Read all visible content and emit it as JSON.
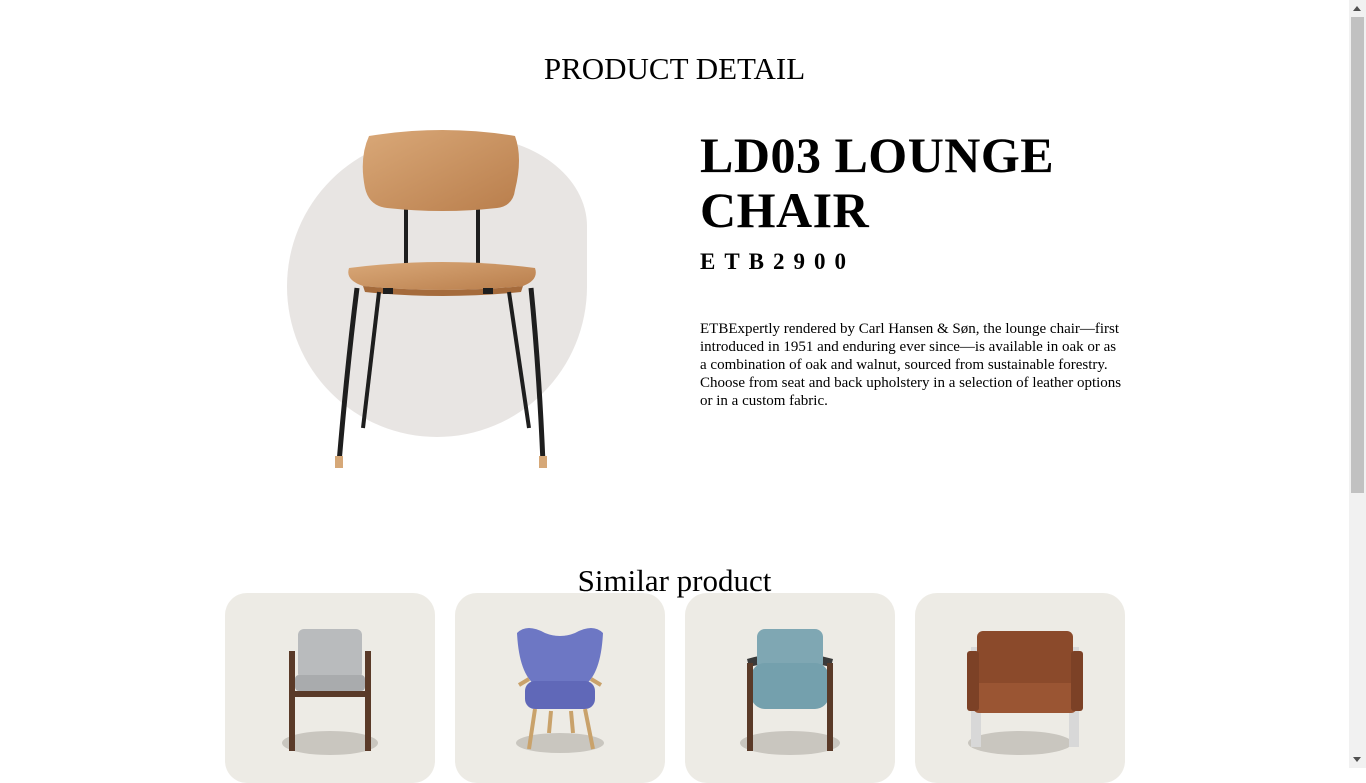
{
  "page": {
    "title": "PRODUCT DETAIL"
  },
  "product": {
    "name": "LD03 LOUNGE CHAIR",
    "code": "ETB2900",
    "description": "ETBExpertly rendered by Carl Hansen & Søn, the lounge chair—first introduced in 1951 and enduring ever since—is available in oak or as a combination of oak and walnut, sourced from sustainable forestry. Choose from seat and back upholstery in a selection of leather options or in a custom fabric."
  },
  "similar": {
    "title": "Similar product",
    "items": [
      {
        "name": "grey-upholstered-armchair",
        "color": "#b9bbbd",
        "frame": "#5a3a28"
      },
      {
        "name": "blue-wingback-chair",
        "color": "#6d77c4",
        "frame": "#c9a26b"
      },
      {
        "name": "teal-lounge-chair",
        "color": "#7fa7b3",
        "frame": "#5a3a28"
      },
      {
        "name": "brown-leather-armchair",
        "color": "#8b4a2b",
        "frame": "#d8d8d8"
      }
    ]
  }
}
